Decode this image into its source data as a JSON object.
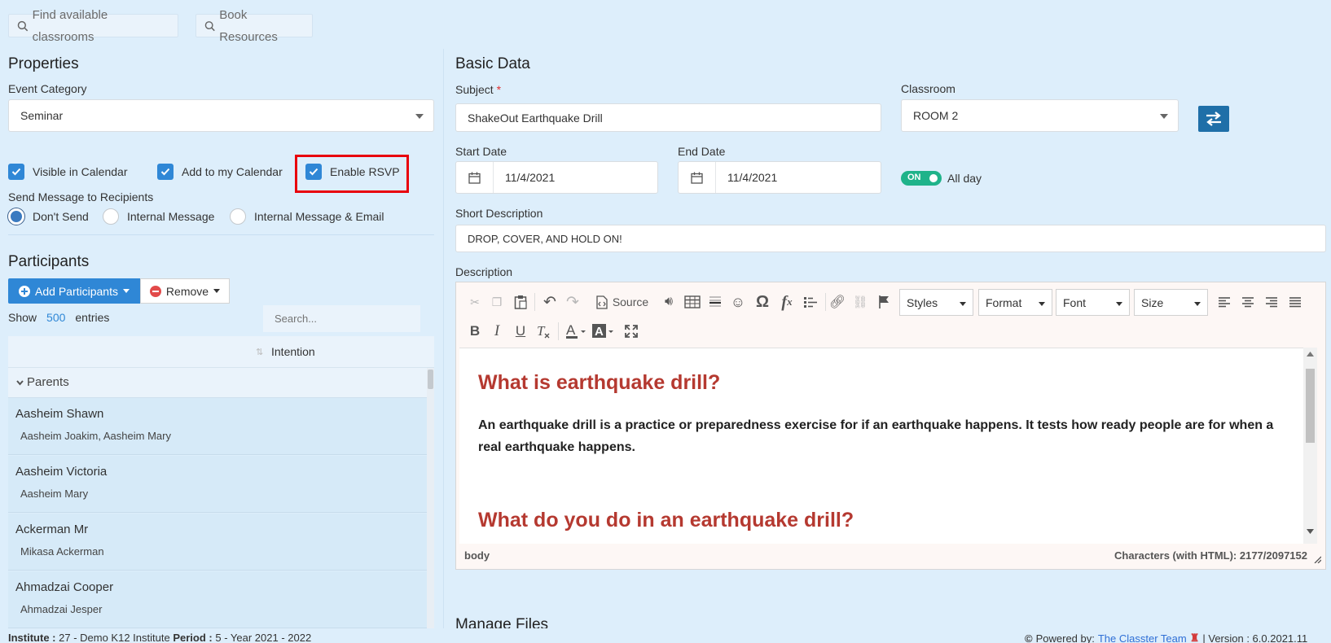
{
  "top_buttons": {
    "find_classrooms": "Find available classrooms",
    "book_resources": "Book Resources"
  },
  "properties": {
    "title": "Properties",
    "event_category_label": "Event Category",
    "event_category_value": "Seminar",
    "visible_in_calendar": "Visible in Calendar",
    "add_to_calendar": "Add to my Calendar",
    "enable_rsvp": "Enable RSVP",
    "send_message_label": "Send Message to Recipients",
    "radio_dont_send": "Don't Send",
    "radio_internal": "Internal Message",
    "radio_internal_email": "Internal Message & Email"
  },
  "participants": {
    "title": "Participants",
    "add_button": "Add Participants",
    "remove_button": "Remove",
    "show_label": "Show",
    "show_count": "500",
    "entries_label": "entries",
    "search_placeholder": "Search...",
    "col_intention": "Intention",
    "group_label": "Parents",
    "rows": [
      {
        "name": "Aasheim Shawn",
        "sub": "Aasheim Joakim, Aasheim Mary"
      },
      {
        "name": "Aasheim Victoria",
        "sub": "Aasheim Mary"
      },
      {
        "name": "Ackerman Mr",
        "sub": "Mikasa Ackerman"
      },
      {
        "name": "Ahmadzai Cooper",
        "sub": "Ahmadzai Jesper"
      }
    ]
  },
  "basic": {
    "title": "Basic Data",
    "subject_label": "Subject",
    "required_mark": "*",
    "subject_value": "ShakeOut Earthquake Drill",
    "classroom_label": "Classroom",
    "classroom_value": "ROOM 2",
    "start_label": "Start Date",
    "start_value": "11/4/2021",
    "end_label": "End Date",
    "end_value": "11/4/2021",
    "toggle_on": "ON",
    "all_day": "All day",
    "short_desc_label": "Short Description",
    "short_desc_value": "DROP, COVER, AND HOLD ON!",
    "description_label": "Description"
  },
  "editor": {
    "source": "Source",
    "styles": "Styles",
    "format": "Format",
    "font": "Font",
    "size": "Size",
    "bold": "B",
    "italic": "I",
    "underline": "U",
    "heading1": "What is earthquake drill?",
    "paragraph1": "An earthquake drill is a practice or preparedness exercise for if an earthquake happens. It tests how ready people are for when a real earthquake happens.",
    "heading2": "What do you do in an earthquake drill?",
    "status_path": "body",
    "char_count": "Characters (with HTML): 2177/2097152"
  },
  "manage_files": "Manage Files",
  "footer": {
    "institute_label": "Institute :",
    "institute_value": "27 - Demo K12 Institute",
    "period_label": "Period :",
    "period_value": "5 - Year 2021 - 2022",
    "powered_by": "Powered by:",
    "team_link": "The Classter Team",
    "version": "| Version : 6.0.2021.11"
  },
  "colors": {
    "accent": "#2f87d6",
    "heading_red": "#b53930",
    "toggle_green": "#1fb38a",
    "highlight_border": "#e8000b"
  }
}
